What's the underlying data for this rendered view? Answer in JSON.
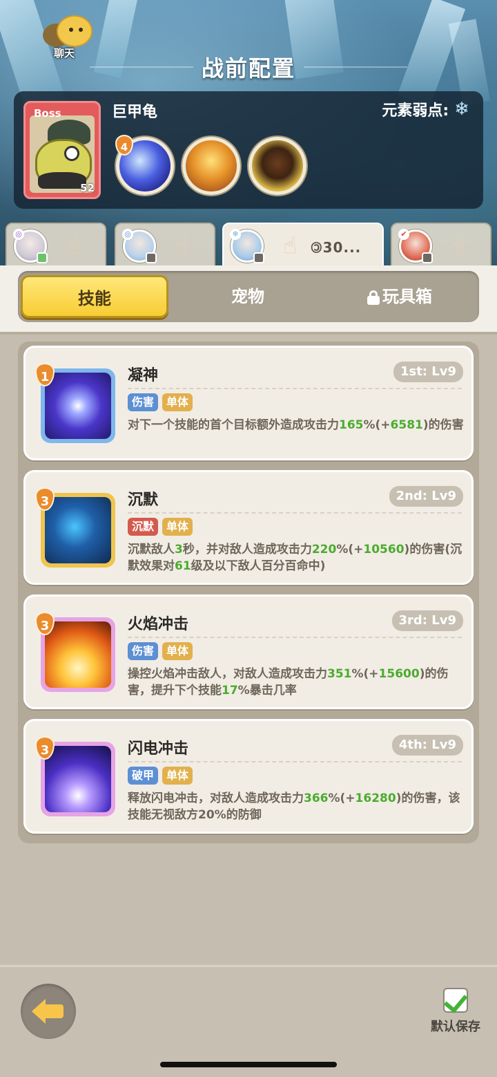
{
  "header": {
    "chat_label": "聊天",
    "title": "战前配置"
  },
  "boss": {
    "tag": "Boss",
    "name": "巨甲龟",
    "level": "52",
    "weakness_label": "元素弱点:",
    "weakness_icon": "snowflake-icon",
    "skills": [
      {
        "icon": "wind-swirl-skill-icon",
        "badge": "4"
      },
      {
        "icon": "crown-spike-skill-icon",
        "badge": ""
      },
      {
        "icon": "beast-roar-skill-icon",
        "badge": ""
      }
    ]
  },
  "heroes": [
    {
      "name": "hero-1",
      "avatar": "white-hair-hero",
      "active": false,
      "cost": ""
    },
    {
      "name": "hero-2",
      "avatar": "blue-hair-hero",
      "active": false,
      "cost": ""
    },
    {
      "name": "hero-3",
      "avatar": "blue-hair-hero-2",
      "active": true,
      "cost": "🄯30..."
    },
    {
      "name": "hero-4",
      "avatar": "red-hair-hero",
      "active": false,
      "cost": ""
    }
  ],
  "tabs": {
    "skills": "技能",
    "pets": "宠物",
    "toys": "玩具箱"
  },
  "skills": [
    {
      "name": "凝神",
      "order": "1st: Lv9",
      "level_badge": "1",
      "tags": [
        {
          "text": "伤害",
          "color": "#5d8fd3"
        },
        {
          "text": "单体",
          "color": "#e2b04c"
        }
      ],
      "desc": [
        {
          "t": "对下一个技能的首个目标额外造成攻击力"
        },
        {
          "t": "165",
          "g": true
        },
        {
          "t": "%(+"
        },
        {
          "t": "6581",
          "g": true
        },
        {
          "t": ")的伤害"
        }
      ]
    },
    {
      "name": "沉默",
      "order": "2nd: Lv9",
      "level_badge": "3",
      "tags": [
        {
          "text": "沉默",
          "color": "#d35a4f"
        },
        {
          "text": "单体",
          "color": "#e2b04c"
        }
      ],
      "desc": [
        {
          "t": "沉默敌人"
        },
        {
          "t": "3",
          "g": true
        },
        {
          "t": "秒，并对敌人造成攻击力"
        },
        {
          "t": "220",
          "g": true
        },
        {
          "t": "%(+"
        },
        {
          "t": "10560",
          "g": true
        },
        {
          "t": ")的伤害(沉默效果对"
        },
        {
          "t": "61",
          "g": true
        },
        {
          "t": "级及以下敌人百分百命中)"
        }
      ]
    },
    {
      "name": "火焰冲击",
      "order": "3rd: Lv9",
      "level_badge": "3",
      "tags": [
        {
          "text": "伤害",
          "color": "#5d8fd3"
        },
        {
          "text": "单体",
          "color": "#e2b04c"
        }
      ],
      "desc": [
        {
          "t": "操控火焰冲击敌人，对敌人造成攻击力"
        },
        {
          "t": "351",
          "g": true
        },
        {
          "t": "%(+"
        },
        {
          "t": "15600",
          "g": true
        },
        {
          "t": ")的伤害，提升下个技能"
        },
        {
          "t": "17",
          "g": true
        },
        {
          "t": "%暴击几率"
        }
      ]
    },
    {
      "name": "闪电冲击",
      "order": "4th: Lv9",
      "level_badge": "3",
      "tags": [
        {
          "text": "破甲",
          "color": "#5d8fd3"
        },
        {
          "text": "单体",
          "color": "#e2b04c"
        }
      ],
      "desc": [
        {
          "t": "释放闪电冲击，对敌人造成攻击力"
        },
        {
          "t": "366",
          "g": true
        },
        {
          "t": "%(+"
        },
        {
          "t": "16280",
          "g": true
        },
        {
          "t": ")的伤害，该技能无视敌方20%的防御"
        }
      ]
    }
  ],
  "footer": {
    "save_label": "默认保存",
    "save_checked": true
  }
}
